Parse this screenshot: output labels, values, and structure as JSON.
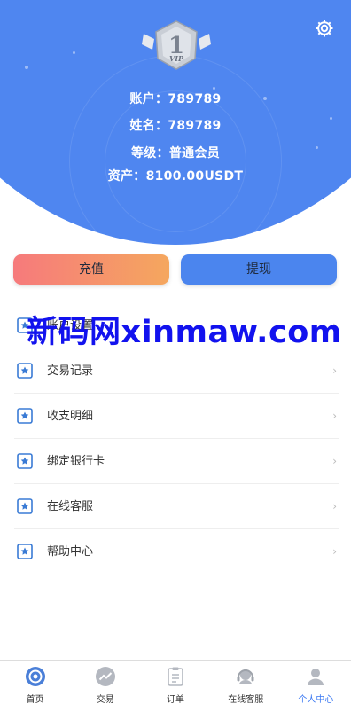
{
  "header": {
    "settings_icon": "gear-icon",
    "vip_badge": {
      "level": "1",
      "text": "VIP"
    },
    "account_label": "账户：",
    "account_value": "789789",
    "name_label": "姓名：",
    "name_value": "789789",
    "level_label": "等级：",
    "level_value": "普通会员",
    "assets_label": "资产：",
    "assets_value": "8100.00USDT"
  },
  "actions": {
    "recharge_label": "充值",
    "withdraw_label": "提现"
  },
  "menu": {
    "items": [
      {
        "label": "账户设置",
        "icon": "star-icon"
      },
      {
        "label": "交易记录",
        "icon": "star-icon"
      },
      {
        "label": "收支明细",
        "icon": "star-icon"
      },
      {
        "label": "绑定银行卡",
        "icon": "star-icon"
      },
      {
        "label": "在线客服",
        "icon": "star-icon"
      },
      {
        "label": "帮助中心",
        "icon": "star-icon"
      }
    ],
    "arrow": "›"
  },
  "watermark": "新码网xinmaw.com",
  "tabbar": {
    "tabs": [
      {
        "label": "首页",
        "icon": "home-icon"
      },
      {
        "label": "交易",
        "icon": "trend-icon"
      },
      {
        "label": "订单",
        "icon": "clipboard-icon"
      },
      {
        "label": "在线客服",
        "icon": "headset-icon"
      },
      {
        "label": "个人中心",
        "icon": "user-icon"
      }
    ],
    "active_index": 4
  },
  "colors": {
    "brand_blue": "#4f86f0",
    "recharge_gradient_start": "#f67a7c",
    "recharge_gradient_end": "#f5a75e",
    "active_tab": "#3a78f2",
    "watermark": "#1212ee"
  }
}
